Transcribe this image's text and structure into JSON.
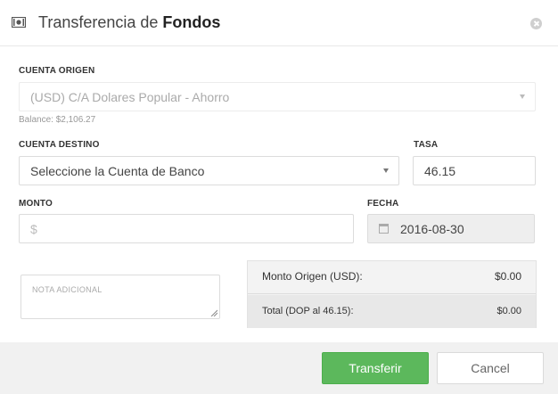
{
  "header": {
    "title_prefix": "Transferencia de ",
    "title_bold": "Fondos",
    "icon": "money-icon"
  },
  "form": {
    "cuenta_origen": {
      "label": "CUENTA ORIGEN",
      "value": "(USD) C/A Dolares Popular - Ahorro",
      "balance": "Balance: $2,106.27"
    },
    "cuenta_destino": {
      "label": "CUENTA DESTINO",
      "value": "Seleccione la Cuenta de Banco"
    },
    "tasa": {
      "label": "TASA",
      "value": "46.15"
    },
    "monto": {
      "label": "MONTO",
      "placeholder": "$"
    },
    "fecha": {
      "label": "FECHA",
      "value": "2016-08-30",
      "icon": "calendar-icon"
    },
    "nota": {
      "placeholder": "NOTA ADICIONAL"
    }
  },
  "summary": {
    "monto_origen_label": "Monto Origen (USD):",
    "monto_origen_value": "$0.00",
    "total_label": "Total (DOP al 46.15):",
    "total_value": "$0.00"
  },
  "footer": {
    "transfer_label": "Transferir",
    "cancel_label": "Cancel"
  },
  "colors": {
    "primary": "#5cb85c",
    "header_border": "#e8e8e8",
    "footer_bg": "#f1f1f1"
  }
}
